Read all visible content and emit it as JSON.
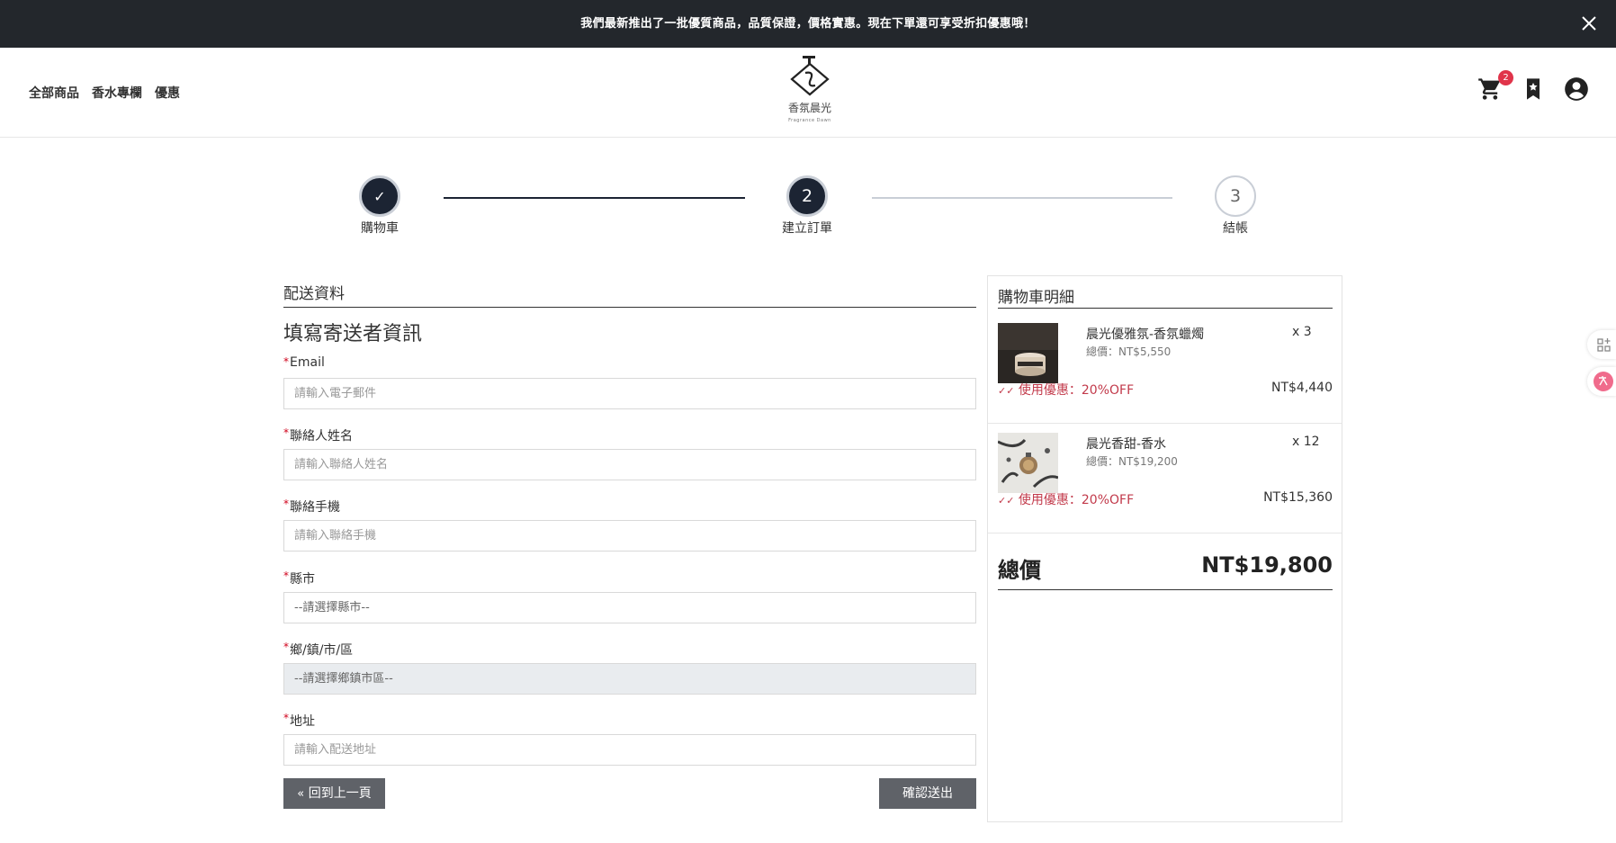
{
  "announcement": {
    "text": "我們最新推出了一批優質商品，品質保證，價格實惠。現在下單還可享受折扣優惠哦！"
  },
  "header": {
    "nav": [
      "全部商品",
      "香水專欄",
      "優惠"
    ],
    "logo_name": "香氛晨光",
    "logo_sub": "Fragrance Dawn",
    "cart_count": "2"
  },
  "stepper": {
    "steps": [
      {
        "number": "✓",
        "label": "購物車",
        "state": "done"
      },
      {
        "number": "2",
        "label": "建立訂單",
        "state": "active"
      },
      {
        "number": "3",
        "label": "結帳",
        "state": "todo"
      }
    ]
  },
  "form": {
    "section_title": "配送資料",
    "heading": "填寫寄送者資訊",
    "required_mark": "*",
    "fields": [
      {
        "label": "Email",
        "placeholder": "請輸入電子郵件"
      },
      {
        "label": "聯絡人姓名",
        "placeholder": "請輸入聯絡人姓名"
      },
      {
        "label": "聯絡手機",
        "placeholder": "請輸入聯絡手機"
      },
      {
        "label": "縣市",
        "value": "--請選擇縣市--"
      },
      {
        "label": "鄉/鎮/市/區",
        "value": "--請選擇鄉鎮市區--"
      },
      {
        "label": "地址",
        "placeholder": "請輸入配送地址"
      }
    ],
    "back_label": "回到上一頁",
    "submit_label": "確認送出"
  },
  "cart": {
    "title": "購物車明細",
    "items": [
      {
        "name": "晨光優雅氛-香氛蠟燭",
        "qty": "x 3",
        "subtotal": "總價：NT$5,550",
        "discount": "使用優惠：20%OFF",
        "price": "NT$4,440"
      },
      {
        "name": "晨光香甜-香水",
        "qty": "x 12",
        "subtotal": "總價：NT$19,200",
        "discount": "使用優惠：20%OFF",
        "price": "NT$15,360"
      }
    ],
    "total_label": "總價",
    "total_value": "NT$19,800"
  },
  "colors": {
    "announcement_bg": "#23272c",
    "step_active": "#1c2433",
    "discount": "#c23a4b",
    "badge": "#e0344a",
    "button": "#5f6268"
  }
}
